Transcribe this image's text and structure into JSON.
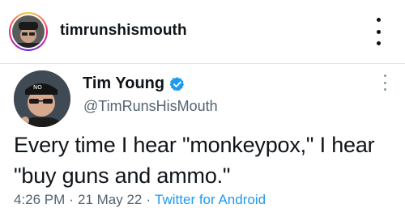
{
  "instagram_header": {
    "username": "timrunshismouth",
    "avatar_icon": "profile-photo",
    "menu_icon": "more-vertical-icon"
  },
  "tweet": {
    "display_name": "Tim Young",
    "verified_icon": "verified-badge-icon",
    "verified_color": "#1d9bf0",
    "handle": "@TimRunsHisMouth",
    "text": "Every time I hear \"monkeypox,\" I hear \"buy guns and ammo.\"",
    "time": "4:26 PM",
    "separator": "·",
    "date": "21 May 22",
    "source": "Twitter for Android",
    "source_color": "#1d9bf0"
  }
}
